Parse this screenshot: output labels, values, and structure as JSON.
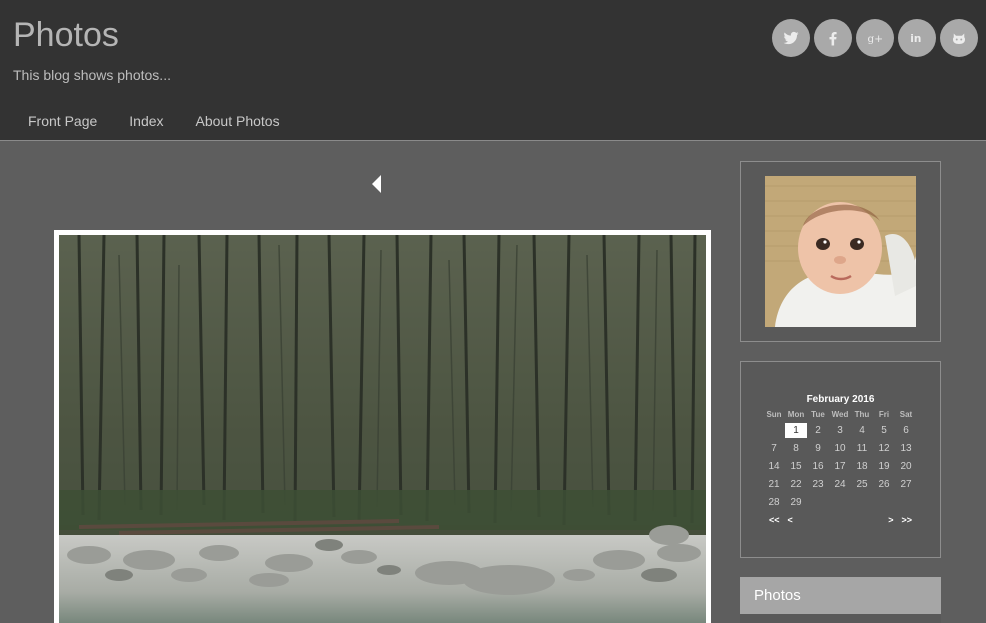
{
  "site": {
    "title": "Photos",
    "description": "This blog shows photos..."
  },
  "social": [
    {
      "name": "twitter",
      "icon": "twitter-icon"
    },
    {
      "name": "facebook",
      "icon": "facebook-icon"
    },
    {
      "name": "google-plus",
      "icon": "google-plus-icon"
    },
    {
      "name": "linkedin",
      "icon": "linkedin-icon"
    },
    {
      "name": "github",
      "icon": "github-icon"
    }
  ],
  "nav": {
    "items": [
      "Front Page",
      "Index",
      "About Photos"
    ]
  },
  "post": {
    "prev_icon": "triangle-left-icon",
    "photo": "forest-river-photo"
  },
  "sidebar": {
    "avatar": "baby-portrait-photo",
    "calendar": {
      "caption": "February 2016",
      "weekdays": [
        "Sun",
        "Mon",
        "Tue",
        "Wed",
        "Thu",
        "Fri",
        "Sat"
      ],
      "weeks": [
        [
          "",
          "1",
          "2",
          "3",
          "4",
          "5",
          "6"
        ],
        [
          "7",
          "8",
          "9",
          "10",
          "11",
          "12",
          "13"
        ],
        [
          "14",
          "15",
          "16",
          "17",
          "18",
          "19",
          "20"
        ],
        [
          "21",
          "22",
          "23",
          "24",
          "25",
          "26",
          "27"
        ],
        [
          "28",
          "29",
          "",
          "",
          "",
          "",
          ""
        ]
      ],
      "highlighted_day": "1",
      "nav": {
        "first": "<<",
        "prev": "<",
        "next": ">",
        "last": ">>"
      }
    },
    "photos_widget": {
      "title": "Photos"
    }
  },
  "colors": {
    "header_bg": "#333333",
    "page_bg": "#5e5e5e",
    "widget_bg": "#595959",
    "social_bg": "#a9a9a9",
    "widget_bar": "#a6a6a6"
  }
}
